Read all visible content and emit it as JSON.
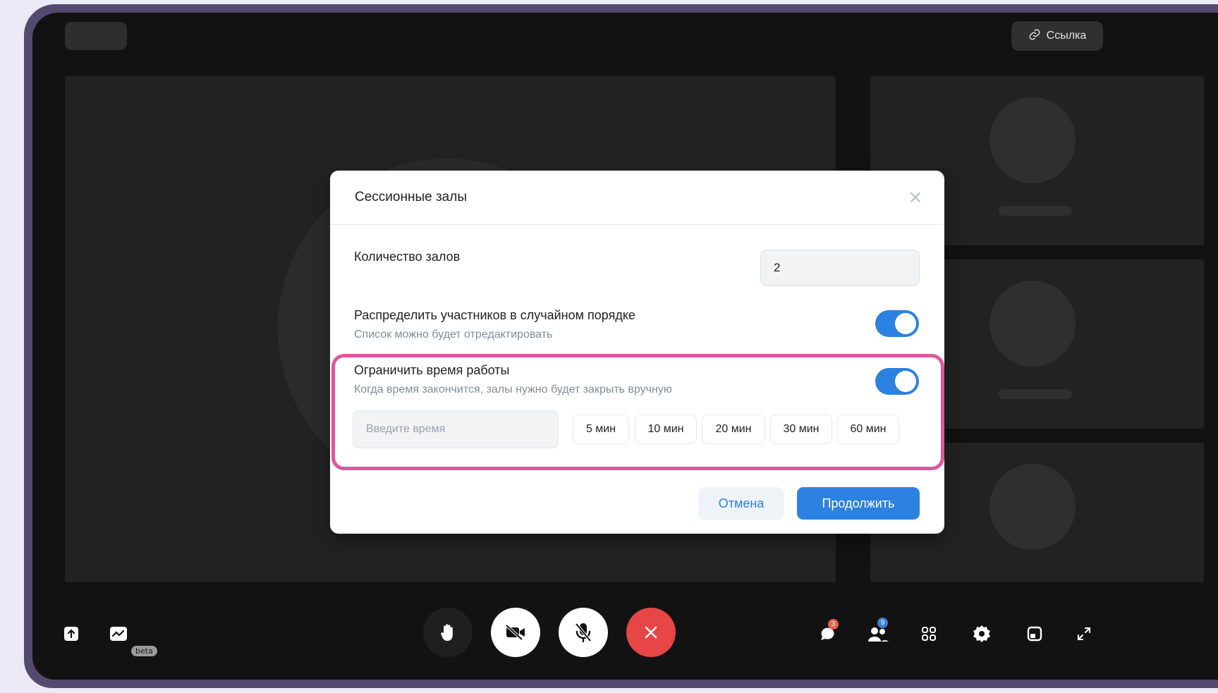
{
  "header": {
    "link_label": "Ссылка"
  },
  "dialog": {
    "title": "Сессионные залы",
    "rooms_count_label": "Количество залов",
    "rooms_count_value": "2",
    "random_label": "Распределить участников в случайном порядке",
    "random_sub": "Список можно будет отредактировать",
    "random_enabled": true,
    "limit_label": "Ограничить время работы",
    "limit_sub": "Когда время закончится, залы нужно будет закрыть вручную",
    "limit_enabled": true,
    "time_placeholder": "Введите время",
    "time_options": [
      "5 мин",
      "10 мин",
      "20 мин",
      "30 мин",
      "60 мин"
    ],
    "cancel_label": "Отмена",
    "continue_label": "Продолжить"
  },
  "toolbar": {
    "beta_label": "beta",
    "chat_badge": "3",
    "participants_badge": "9"
  },
  "colors": {
    "accent": "#2d81e0",
    "highlight": "#e0559f",
    "end_call": "#e64646"
  }
}
